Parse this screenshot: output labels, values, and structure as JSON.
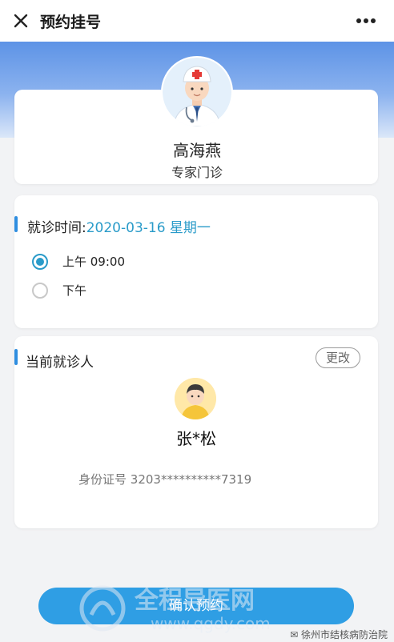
{
  "header": {
    "title": "预约挂号",
    "close_icon": "close-icon",
    "more_icon": "more-dots-icon"
  },
  "doctor": {
    "name": "高海燕",
    "clinic_type": "专家门诊"
  },
  "schedule": {
    "label": "就诊时间:",
    "value": "2020-03-16 星期一",
    "options": [
      {
        "label": "上午 09:00",
        "selected": true
      },
      {
        "label": "下午",
        "selected": false
      }
    ]
  },
  "patient": {
    "section_title": "当前就诊人",
    "change_label": "更改",
    "name": "张*松",
    "id_label": "身份证号",
    "id_value": "3203**********7319"
  },
  "actions": {
    "confirm_label": "确认预约"
  },
  "watermark": {
    "text": "全程导医网",
    "url": "www.qgdy.com"
  },
  "footer": {
    "source": "徐州市结核病防治院"
  },
  "colors": {
    "accent": "#2a9bc9",
    "banner_top": "#5d93e6",
    "button": "#2f9ee4"
  }
}
